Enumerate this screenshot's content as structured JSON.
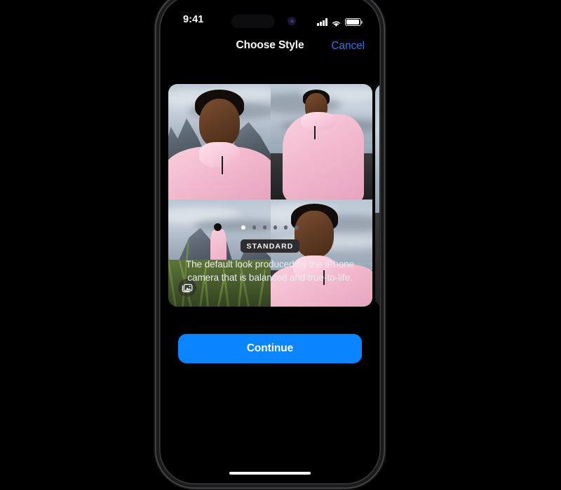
{
  "status_bar": {
    "time": "9:41",
    "signal_icon": "cellular-signal-icon",
    "wifi_icon": "wifi-icon",
    "battery_icon": "battery-full-icon"
  },
  "nav": {
    "title": "Choose Style",
    "cancel_label": "Cancel"
  },
  "carousel": {
    "photo_stack_icon": "photo-stack-icon",
    "dots_total": 6,
    "active_dot_index": 0,
    "photos": [
      {
        "caption": "close-up selfie in pink jacket with mountains"
      },
      {
        "caption": "three-quarter view in pink jacket on black sand beach"
      },
      {
        "caption": "full body figure in pink outfit in tall grass by mountains"
      },
      {
        "caption": "portrait in pink jacket with overcast ocean sky"
      }
    ]
  },
  "style": {
    "name": "STANDARD",
    "description": "The default look produced by the iPhone camera that is balanced and true-to-life."
  },
  "footer": {
    "continue_label": "Continue",
    "home_indicator": "home-indicator"
  },
  "colors": {
    "accent_blue": "#0a84ff",
    "cancel_blue": "#2b72ec",
    "badge_bg": "#2e2e30",
    "screen_bg": "#000000"
  }
}
